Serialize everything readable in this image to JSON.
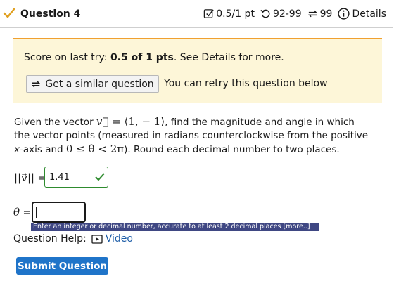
{
  "question": {
    "title": "Question 4",
    "score": "0.5/1 pt",
    "attempts": "92-99",
    "retries": "99",
    "details_label": "Details"
  },
  "notice": {
    "score_prefix": "Score on last try: ",
    "score_value": "0.5 of 1 pts",
    "score_suffix": ". See Details for more.",
    "similar_button": "Get a similar question",
    "retry_text": "You can retry this question below"
  },
  "problem": {
    "t1": "Given the vector ",
    "vector": "⟨1, − 1⟩",
    "t2": ", find the magnitude and angle in which the vector points (measured in radians counterclockwise from the positive ",
    "axis": "x",
    "t3": "-axis and ",
    "range": "0 ≤ θ < 2π",
    "t4": "). Round each decimal number to two places."
  },
  "answers": {
    "magnitude_label_math": "||v⃗||",
    "equals": " =",
    "magnitude_value": "1.41",
    "angle_label": "θ",
    "angle_value": ""
  },
  "tooltip": "Enter an integer or decimal number, accurate to at least 2 decimal places [more..]",
  "help": {
    "label": "Question Help:",
    "video": "Video"
  },
  "submit_label": "Submit Question",
  "colors": {
    "notice_bg": "#fdf6d8",
    "notice_accent": "#f0a030",
    "correct_green": "#2e8b2e",
    "submit_blue": "#1f74c9",
    "tooltip_bg": "#3f4783",
    "link_blue": "#1f5ea8"
  },
  "icons": [
    "checkmark-icon",
    "checkbox-icon",
    "history-icon",
    "retry-icon",
    "info-icon",
    "video-icon",
    "correct-check-icon"
  ]
}
